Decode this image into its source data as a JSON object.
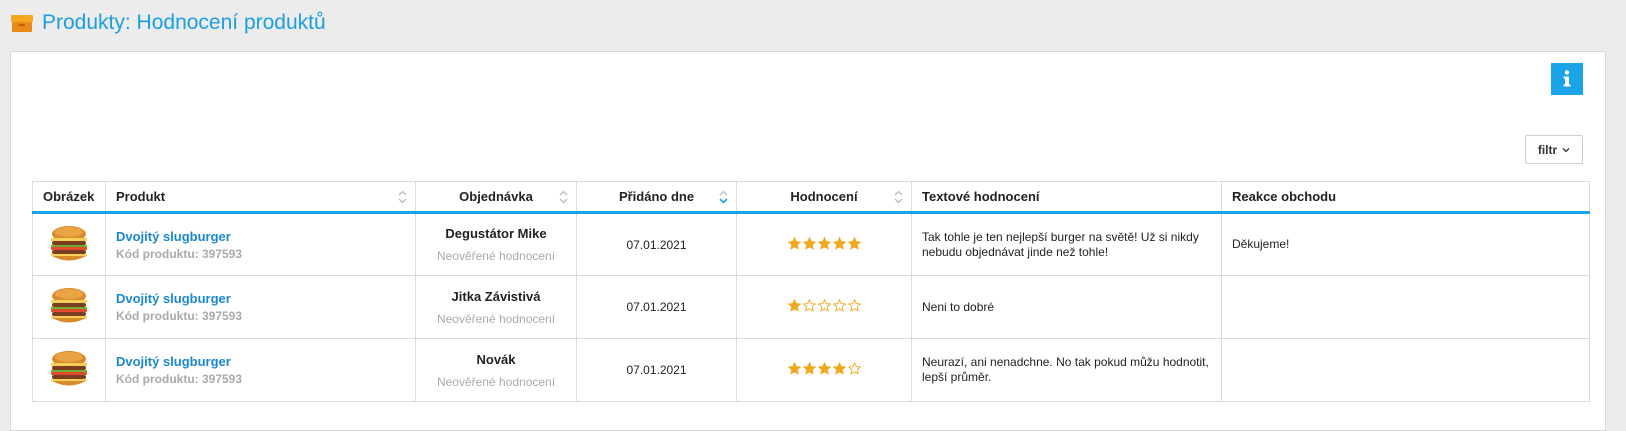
{
  "header": {
    "title": "Produkty: Hodnocení produktů",
    "icon": "box-icon"
  },
  "toolbar": {
    "filter_label": "filtr",
    "info_icon": "info-icon"
  },
  "colors": {
    "accent": "#1aa3e6",
    "star": "#f0a81e",
    "link": "#1a88d0"
  },
  "table": {
    "columns": [
      "Obrázek",
      "Produkt",
      "Objednávka",
      "Přidáno dne",
      "Hodnocení",
      "Textové hodnocení",
      "Reakce obchodu"
    ],
    "rows": [
      {
        "product": "Dvojitý slugburger",
        "code": "Kód produktu: 397593",
        "customer": "Degustátor Mike",
        "status": "Neověřené hodnocení",
        "date": "07.01.2021",
        "rating": 5,
        "review": "Tak tohle je ten nejlepší burger na světě! Už si nikdy nebudu objednávat jinde než tohle!",
        "reaction": "Děkujeme!"
      },
      {
        "product": "Dvojitý slugburger",
        "code": "Kód produktu: 397593",
        "customer": "Jitka Závistivá",
        "status": "Neověřené hodnocení",
        "date": "07.01.2021",
        "rating": 1,
        "review": "Neni to dobré",
        "reaction": ""
      },
      {
        "product": "Dvojitý slugburger",
        "code": "Kód produktu: 397593",
        "customer": "Novák",
        "status": "Neověřené hodnocení",
        "date": "07.01.2021",
        "rating": 4,
        "review": "Neurazí, ani nenadchne. No tak pokud můžu hodnotit, lepší průměr.",
        "reaction": ""
      }
    ]
  }
}
